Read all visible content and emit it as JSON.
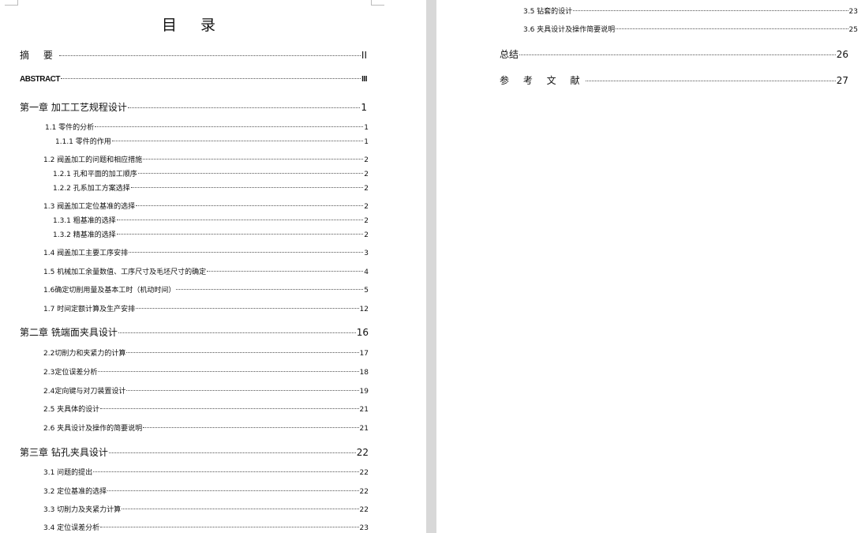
{
  "left_page": {
    "title": "目 录",
    "entries": [
      {
        "text": "摘  要",
        "page": "II"
      },
      {
        "text": "ABSTRACT",
        "page": "III"
      },
      {
        "text": "第一章 加工工艺规程设计",
        "page": "1"
      },
      {
        "text": "1.1 零件的分析",
        "page": "1"
      },
      {
        "text": "1.1.1 零件的作用",
        "page": "1"
      },
      {
        "text": "1.2 阀盖加工的问题和相应措施",
        "page": "2"
      },
      {
        "text": "1.2.1 孔和平面的加工顺序",
        "page": "2"
      },
      {
        "text": "1.2.2 孔系加工方案选择",
        "page": "2"
      },
      {
        "text": "1.3 阀盖加工定位基准的选择",
        "page": "2"
      },
      {
        "text": "1.3.1 粗基准的选择",
        "page": "2"
      },
      {
        "text": "1.3.2 精基准的选择",
        "page": "2"
      },
      {
        "text": "1.4 阀盖加工主要工序安排",
        "page": "3"
      },
      {
        "text": "1.5 机械加工余量数值、工序尺寸及毛坯尺寸的确定",
        "page": "4"
      },
      {
        "text": "1.6确定切削用量及基本工时（机动时间）",
        "page": "5"
      },
      {
        "text": "1.7 时间定额计算及生产安排",
        "page": "12"
      },
      {
        "text": "第二章 铣端面夹具设计",
        "page": "16"
      },
      {
        "text": "2.2切削力和夹紧力的计算",
        "page": "17"
      },
      {
        "text": "2.3定位误差分析",
        "page": "18"
      },
      {
        "text": "2.4定向键与对刀装置设计",
        "page": "19"
      },
      {
        "text": "2.5 夹具体的设计",
        "page": "21"
      },
      {
        "text": "2.6 夹具设计及操作的简要说明",
        "page": "21"
      },
      {
        "text": "第三章 钻孔夹具设计",
        "page": "22"
      },
      {
        "text": "3.1 问题的提出",
        "page": "22"
      },
      {
        "text": "3.2 定位基准的选择",
        "page": "22"
      },
      {
        "text": "3.3 切削力及夹紧力计算",
        "page": "22"
      },
      {
        "text": "3.4 定位误差分析",
        "page": "23"
      }
    ]
  },
  "right_page": {
    "entries": [
      {
        "text": "3.5 钻套的设计",
        "page": "23"
      },
      {
        "text": "3.6 夹具设计及操作简要说明",
        "page": "25"
      },
      {
        "text": "总结",
        "page": "26"
      },
      {
        "text": "参 考 文 献",
        "page": "27"
      }
    ]
  }
}
